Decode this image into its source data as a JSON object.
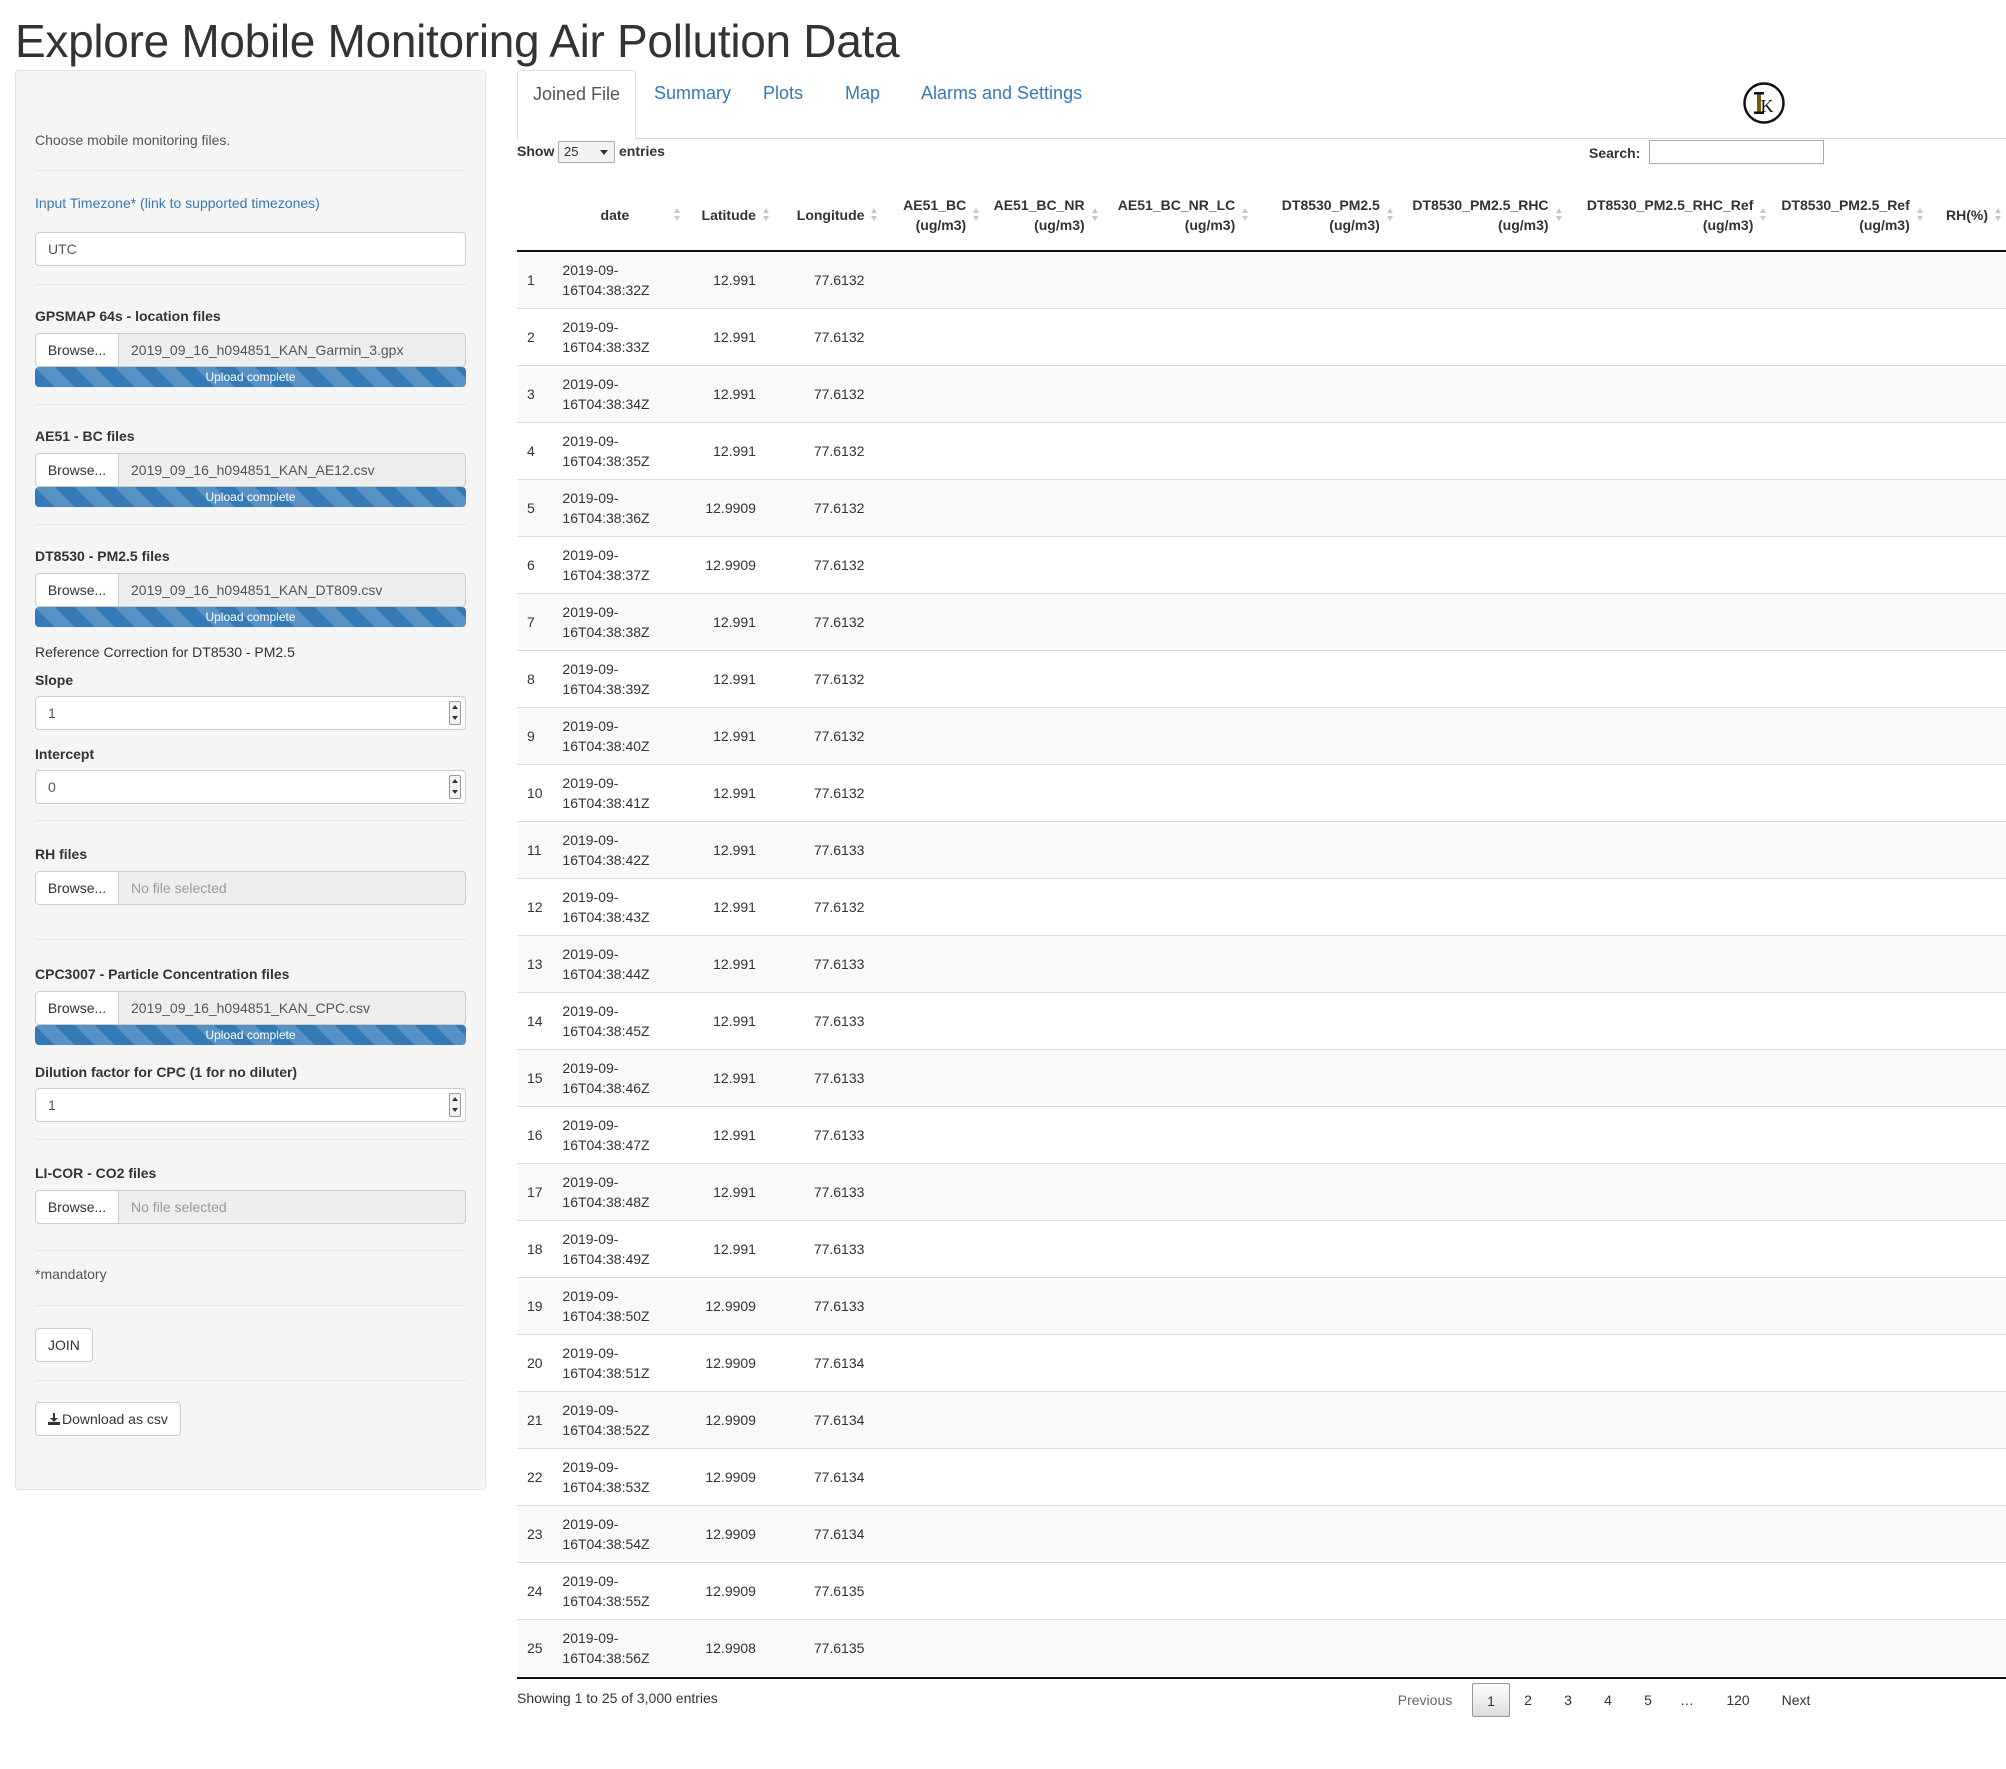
{
  "page": {
    "title": "Explore Mobile Monitoring Air Pollution Data"
  },
  "sidebar": {
    "intro": "Choose mobile monitoring files.",
    "timezone_label": "Input Timezone* (link to supported timezones)",
    "timezone_value": "UTC",
    "gps": {
      "label": "GPSMAP 64s - location files",
      "browse": "Browse...",
      "file": "2019_09_16_h094851_KAN_Garmin_3.gpx",
      "progress": "Upload complete",
      "progress_fraction": 1.0
    },
    "ae51": {
      "label": "AE51 - BC files",
      "browse": "Browse...",
      "file": "2019_09_16_h094851_KAN_AE12.csv",
      "progress": "Upload complete",
      "progress_fraction": 1.0
    },
    "dt8530": {
      "label": "DT8530 - PM2.5 files",
      "browse": "Browse...",
      "file": "2019_09_16_h094851_KAN_DT809.csv",
      "progress": "Upload complete",
      "progress_fraction": 1.0
    },
    "ref_correction_label": "Reference Correction for DT8530 - PM2.5",
    "slope_label": "Slope",
    "slope_value": "1",
    "intercept_label": "Intercept",
    "intercept_value": "0",
    "rh": {
      "label": "RH files",
      "browse": "Browse...",
      "file": "No file selected"
    },
    "cpc": {
      "label": "CPC3007 - Particle Concentration files",
      "browse": "Browse...",
      "file": "2019_09_16_h094851_KAN_CPC.csv",
      "progress": "Upload complete",
      "progress_fraction": 1.0
    },
    "dilution_label": "Dilution factor for CPC (1 for no diluter)",
    "dilution_value": "1",
    "licor": {
      "label": "LI-COR - CO2 files",
      "browse": "Browse...",
      "file": "No file selected"
    },
    "mandatory_note": "*mandatory",
    "join_button": "JOIN",
    "download_button": "Download as csv"
  },
  "tabs": [
    {
      "label": "Joined File",
      "active": true
    },
    {
      "label": "Summary",
      "active": false
    },
    {
      "label": "Plots",
      "active": false
    },
    {
      "label": "Map",
      "active": false
    },
    {
      "label": "Alarms and Settings",
      "active": false
    }
  ],
  "logo_letter": "K",
  "table_controls": {
    "show_label": "Show",
    "page_length": "25",
    "entries_label": "entries",
    "search_label": "Search:",
    "search_value": ""
  },
  "table": {
    "headers": [
      {
        "line1": "",
        "line2": ""
      },
      {
        "line1": "date",
        "line2": ""
      },
      {
        "line1": "Latitude",
        "line2": ""
      },
      {
        "line1": "Longitude",
        "line2": ""
      },
      {
        "line1": "AE51_BC",
        "line2": "(ug/m3)"
      },
      {
        "line1": "AE51_BC_NR",
        "line2": "(ug/m3)"
      },
      {
        "line1": "AE51_BC_NR_LC",
        "line2": "(ug/m3)"
      },
      {
        "line1": "DT8530_PM2.5",
        "line2": "(ug/m3)"
      },
      {
        "line1": "DT8530_PM2.5_RHC",
        "line2": "(ug/m3)"
      },
      {
        "line1": "DT8530_PM2.5_RHC_Ref",
        "line2": "(ug/m3)"
      },
      {
        "line1": "DT8530_PM2.5_Ref",
        "line2": "(ug/m3)"
      },
      {
        "line1": "RH(%)",
        "line2": ""
      }
    ],
    "rows": [
      {
        "idx": "1",
        "date1": "2019-09-",
        "date2": "16T04:38:32Z",
        "lat": "12.991",
        "lon": "77.6132"
      },
      {
        "idx": "2",
        "date1": "2019-09-",
        "date2": "16T04:38:33Z",
        "lat": "12.991",
        "lon": "77.6132"
      },
      {
        "idx": "3",
        "date1": "2019-09-",
        "date2": "16T04:38:34Z",
        "lat": "12.991",
        "lon": "77.6132"
      },
      {
        "idx": "4",
        "date1": "2019-09-",
        "date2": "16T04:38:35Z",
        "lat": "12.991",
        "lon": "77.6132"
      },
      {
        "idx": "5",
        "date1": "2019-09-",
        "date2": "16T04:38:36Z",
        "lat": "12.9909",
        "lon": "77.6132"
      },
      {
        "idx": "6",
        "date1": "2019-09-",
        "date2": "16T04:38:37Z",
        "lat": "12.9909",
        "lon": "77.6132"
      },
      {
        "idx": "7",
        "date1": "2019-09-",
        "date2": "16T04:38:38Z",
        "lat": "12.991",
        "lon": "77.6132"
      },
      {
        "idx": "8",
        "date1": "2019-09-",
        "date2": "16T04:38:39Z",
        "lat": "12.991",
        "lon": "77.6132"
      },
      {
        "idx": "9",
        "date1": "2019-09-",
        "date2": "16T04:38:40Z",
        "lat": "12.991",
        "lon": "77.6132"
      },
      {
        "idx": "10",
        "date1": "2019-09-",
        "date2": "16T04:38:41Z",
        "lat": "12.991",
        "lon": "77.6132"
      },
      {
        "idx": "11",
        "date1": "2019-09-",
        "date2": "16T04:38:42Z",
        "lat": "12.991",
        "lon": "77.6133"
      },
      {
        "idx": "12",
        "date1": "2019-09-",
        "date2": "16T04:38:43Z",
        "lat": "12.991",
        "lon": "77.6132"
      },
      {
        "idx": "13",
        "date1": "2019-09-",
        "date2": "16T04:38:44Z",
        "lat": "12.991",
        "lon": "77.6133"
      },
      {
        "idx": "14",
        "date1": "2019-09-",
        "date2": "16T04:38:45Z",
        "lat": "12.991",
        "lon": "77.6133"
      },
      {
        "idx": "15",
        "date1": "2019-09-",
        "date2": "16T04:38:46Z",
        "lat": "12.991",
        "lon": "77.6133"
      },
      {
        "idx": "16",
        "date1": "2019-09-",
        "date2": "16T04:38:47Z",
        "lat": "12.991",
        "lon": "77.6133"
      },
      {
        "idx": "17",
        "date1": "2019-09-",
        "date2": "16T04:38:48Z",
        "lat": "12.991",
        "lon": "77.6133"
      },
      {
        "idx": "18",
        "date1": "2019-09-",
        "date2": "16T04:38:49Z",
        "lat": "12.991",
        "lon": "77.6133"
      },
      {
        "idx": "19",
        "date1": "2019-09-",
        "date2": "16T04:38:50Z",
        "lat": "12.9909",
        "lon": "77.6133"
      },
      {
        "idx": "20",
        "date1": "2019-09-",
        "date2": "16T04:38:51Z",
        "lat": "12.9909",
        "lon": "77.6134"
      },
      {
        "idx": "21",
        "date1": "2019-09-",
        "date2": "16T04:38:52Z",
        "lat": "12.9909",
        "lon": "77.6134"
      },
      {
        "idx": "22",
        "date1": "2019-09-",
        "date2": "16T04:38:53Z",
        "lat": "12.9909",
        "lon": "77.6134"
      },
      {
        "idx": "23",
        "date1": "2019-09-",
        "date2": "16T04:38:54Z",
        "lat": "12.9909",
        "lon": "77.6134"
      },
      {
        "idx": "24",
        "date1": "2019-09-",
        "date2": "16T04:38:55Z",
        "lat": "12.9909",
        "lon": "77.6135"
      },
      {
        "idx": "25",
        "date1": "2019-09-",
        "date2": "16T04:38:56Z",
        "lat": "12.9908",
        "lon": "77.6135"
      }
    ]
  },
  "footer": {
    "info": "Showing 1 to 25 of 3,000 entries",
    "previous": "Previous",
    "next": "Next",
    "pages": [
      "1",
      "2",
      "3",
      "4",
      "5",
      "…",
      "120"
    ],
    "current_page": "1"
  },
  "colors": {
    "link": "#337ab7",
    "progress": "#337ab7",
    "panel_bg": "#f5f5f5"
  },
  "icons": {
    "download": "download-icon",
    "sort": "sort-icon",
    "logo": "k-logo-icon"
  }
}
